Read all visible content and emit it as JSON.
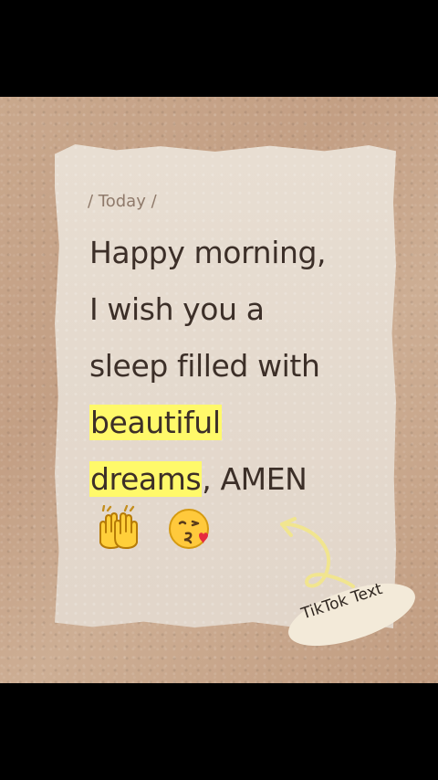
{
  "header": {
    "today": "/ Today /"
  },
  "message": {
    "line1": "Happy morning,",
    "line2": "I wish you a",
    "line3": "sleep filled with",
    "line4": "beautiful",
    "line5_highlight": "dreams",
    "line5_rest": ", AMEN"
  },
  "emoji": {
    "left": "raising-hands-icon",
    "right": "kissing-face-with-heart-icon"
  },
  "badge": {
    "label": "TikTok Text"
  },
  "colors": {
    "cardboard": "#c6a487",
    "paper": "#e5dacd",
    "text": "#3c2f28",
    "highlight": "#fff96a",
    "arrow": "#f0e58b"
  }
}
